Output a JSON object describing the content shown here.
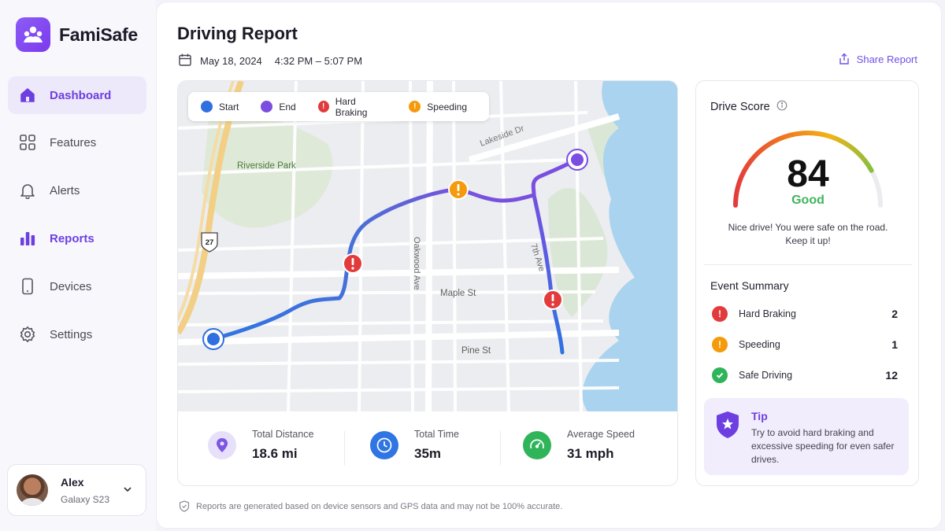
{
  "app": {
    "name": "FamiSafe",
    "brand_color": "#7c3aed"
  },
  "sidebar": {
    "items": [
      {
        "label": "Dashboard",
        "icon": "home-icon",
        "active": true
      },
      {
        "label": "Features",
        "icon": "grid-icon"
      },
      {
        "label": "Alerts",
        "icon": "bell-icon"
      },
      {
        "label": "Reports",
        "icon": "bar-chart-icon"
      },
      {
        "label": "Devices",
        "icon": "phone-icon"
      },
      {
        "label": "Settings",
        "icon": "gear-icon"
      }
    ],
    "profile": {
      "name": "Alex",
      "device": "Galaxy S23"
    }
  },
  "header": {
    "title": "Driving Report",
    "date": "May 18, 2024",
    "time_range": "4:32 PM – 5:07 PM",
    "share_label": "Share Report"
  },
  "map": {
    "legend": [
      {
        "label": "Start",
        "color": "#2f6fe0"
      },
      {
        "label": "End",
        "color": "#7b4de0"
      },
      {
        "label": "Hard Braking",
        "color": "#e23b3b"
      },
      {
        "label": "Speeding",
        "color": "#f59a0b"
      }
    ],
    "labels": {
      "park": "Riverside Park",
      "lakeside": "Lakeside Dr",
      "oakwood": "Oakwood Ave",
      "seventh": "7th Ave",
      "maple": "Maple St",
      "pine": "Pine St",
      "route": "27"
    }
  },
  "stats": [
    {
      "label": "Total Distance",
      "value": "18.6 mi",
      "icon": "location-pin-icon"
    },
    {
      "label": "Total Time",
      "value": "35m",
      "icon": "clock-icon"
    },
    {
      "label": "Average Speed",
      "value": "31 mph",
      "icon": "speedometer-icon"
    }
  ],
  "drive_score": {
    "title": "Drive Score",
    "value": "84",
    "level": 0.84,
    "rating": "Good",
    "message": "Nice drive! You were safe on the road. Keep it up!"
  },
  "events": {
    "title": "Event Summary",
    "items": [
      {
        "label": "Hard Braking",
        "count": "2",
        "color": "#e23b3b"
      },
      {
        "label": "Speeding",
        "count": "1",
        "color": "#f59a0b"
      },
      {
        "label": "Safe Driving",
        "count": "12",
        "color": "#2fb45a"
      }
    ]
  },
  "tip": {
    "title": "Tip",
    "text": "Try to avoid hard braking and excessive speeding for even safer drives."
  },
  "disclaimer": "Reports are generated based on device sensors and GPS data and may not be 100% accurate."
}
